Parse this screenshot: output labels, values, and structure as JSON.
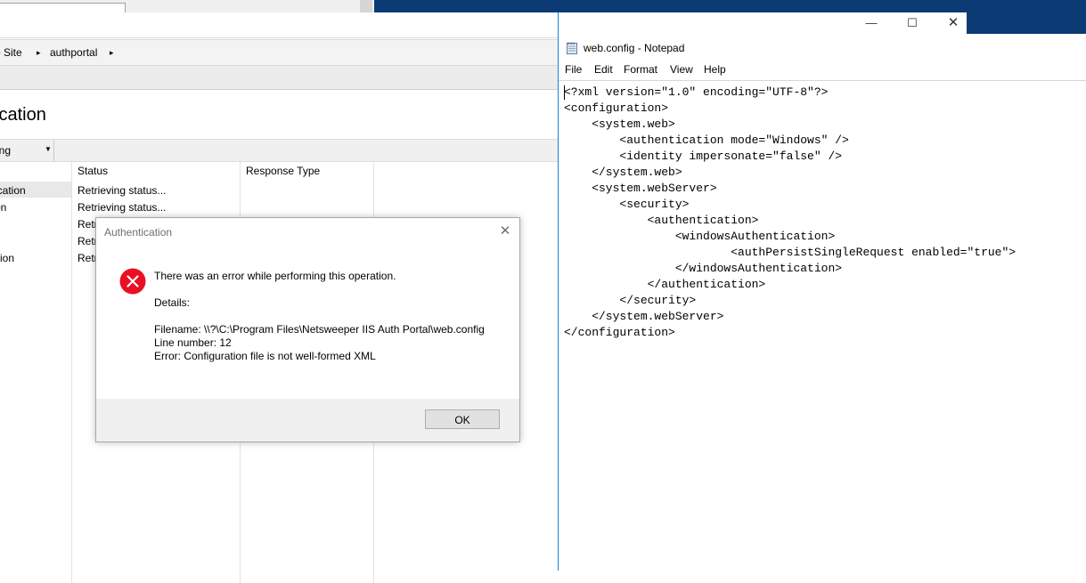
{
  "iis": {
    "breadcrumb": {
      "site": "b Site",
      "arrow1": "▸",
      "app": "authportal",
      "arrow2": "▸"
    },
    "page_title": "ication",
    "group_by": {
      "value": "ing",
      "arrow": "▼"
    },
    "columns": {
      "status": "Status",
      "response_type": "Response Type"
    },
    "rows": [
      {
        "name": "ication",
        "status": "Retrieving status..."
      },
      {
        "name": "on",
        "status": "Retrieving status..."
      },
      {
        "name": "",
        "status": "Retr"
      },
      {
        "name": "n",
        "status": "Retr"
      },
      {
        "name": "ition",
        "status": "Retr"
      }
    ]
  },
  "dialog": {
    "title": "Authentication",
    "close_glyph": "✕",
    "message": "There was an error while performing this operation.",
    "details_label": "Details:",
    "filename": "Filename: \\\\?\\C:\\Program Files\\Netsweeper IIS Auth Portal\\web.config",
    "line_number": "Line number: 12",
    "error": "Error: Configuration file is not well-formed XML",
    "ok_label": "OK",
    "icon": "error-icon"
  },
  "notepad": {
    "title": "web.config - Notepad",
    "controls": {
      "minimize": "—",
      "maximize": "☐",
      "close": "✕"
    },
    "menu": [
      "File",
      "Edit",
      "Format",
      "View",
      "Help"
    ],
    "content": "<?xml version=\"1.0\" encoding=\"UTF-8\"?>\n<configuration>\n    <system.web>\n        <authentication mode=\"Windows\" />\n        <identity impersonate=\"false\" />\n    </system.web>\n    <system.webServer>\n        <security>\n            <authentication>\n                <windowsAuthentication>\n                        <authPersistSingleRequest enabled=\"true\">\n                </windowsAuthentication>\n            </authentication>\n        </security>\n    </system.webServer>\n</configuration>"
  },
  "colors": {
    "error_red": "#e81123",
    "accent_blue": "#1883d7",
    "desktop_blue": "#0b3a75"
  }
}
